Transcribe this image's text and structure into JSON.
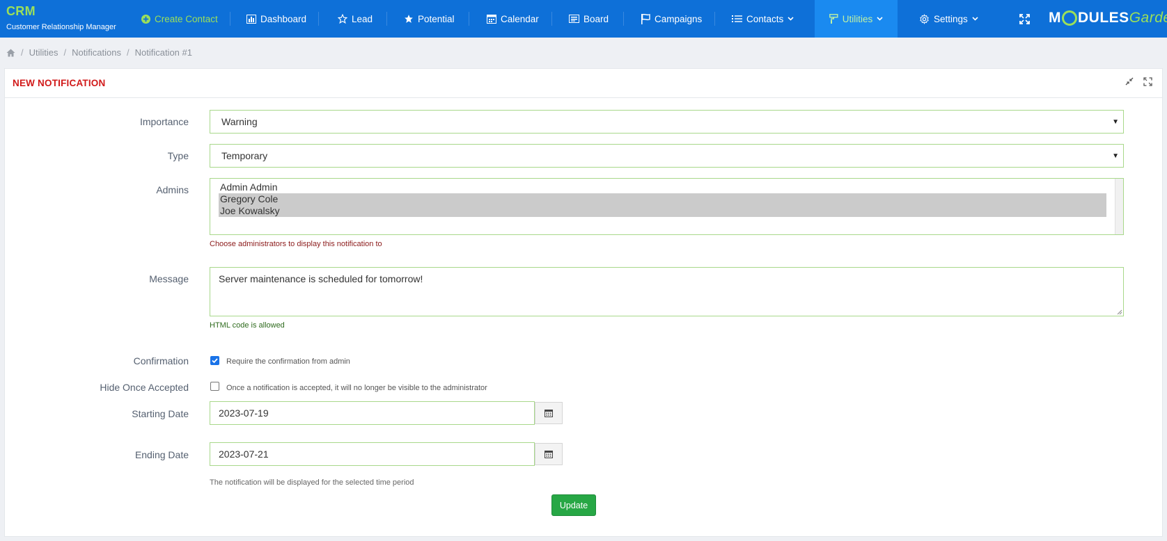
{
  "brand": {
    "title": "CRM",
    "subtitle": "Customer Relationship Manager"
  },
  "nav": {
    "create_contact": "Create Contact",
    "dashboard": "Dashboard",
    "lead": "Lead",
    "potential": "Potential",
    "calendar": "Calendar",
    "board": "Board",
    "campaigns": "Campaigns",
    "contacts": "Contacts",
    "utilities": "Utilities",
    "settings": "Settings"
  },
  "logo": {
    "part1": "M",
    "part2": "DULES",
    "part3": "Garden"
  },
  "breadcrumb": {
    "item1": "Utilities",
    "item2": "Notifications",
    "item3": "Notification #1"
  },
  "panel": {
    "title": "NEW NOTIFICATION"
  },
  "form": {
    "importance": {
      "label": "Importance",
      "value": "Warning"
    },
    "type": {
      "label": "Type",
      "value": "Temporary"
    },
    "admins": {
      "label": "Admins",
      "options": [
        {
          "name": "Admin Admin",
          "selected": false
        },
        {
          "name": "Gregory Cole",
          "selected": true
        },
        {
          "name": "Joe Kowalsky",
          "selected": true
        }
      ],
      "help": "Choose administrators to display this notification to"
    },
    "message": {
      "label": "Message",
      "value": "Server maintenance is scheduled for tomorrow!",
      "help": "HTML code is allowed"
    },
    "confirmation": {
      "label": "Confirmation",
      "checked": true,
      "text": "Require the confirmation from admin"
    },
    "hide_once_accepted": {
      "label": "Hide Once Accepted",
      "checked": false,
      "text": "Once a notification is accepted, it will no longer be visible to the administrator"
    },
    "starting_date": {
      "label": "Starting Date",
      "value": "2023-07-19"
    },
    "ending_date": {
      "label": "Ending Date",
      "value": "2023-07-21",
      "help": "The notification will be displayed for the selected time period"
    },
    "update_label": "Update"
  },
  "colors": {
    "navbar": "#0e70d8",
    "accent_green": "#9be05a",
    "title_red": "#d11a1a",
    "button_green": "#27a745",
    "help_red": "#8b1a1a",
    "help_green": "#2f6b1e"
  },
  "icons": [
    "plus-circle-icon",
    "bar-chart-icon",
    "star-outline-icon",
    "star-icon",
    "calendar-icon",
    "board-icon",
    "flag-icon",
    "list-icon",
    "chevron-down-icon",
    "paint-roller-icon",
    "gear-icon",
    "expand-icon",
    "home-icon",
    "compress-icon",
    "fullscreen-icon",
    "calendar-small-icon"
  ]
}
